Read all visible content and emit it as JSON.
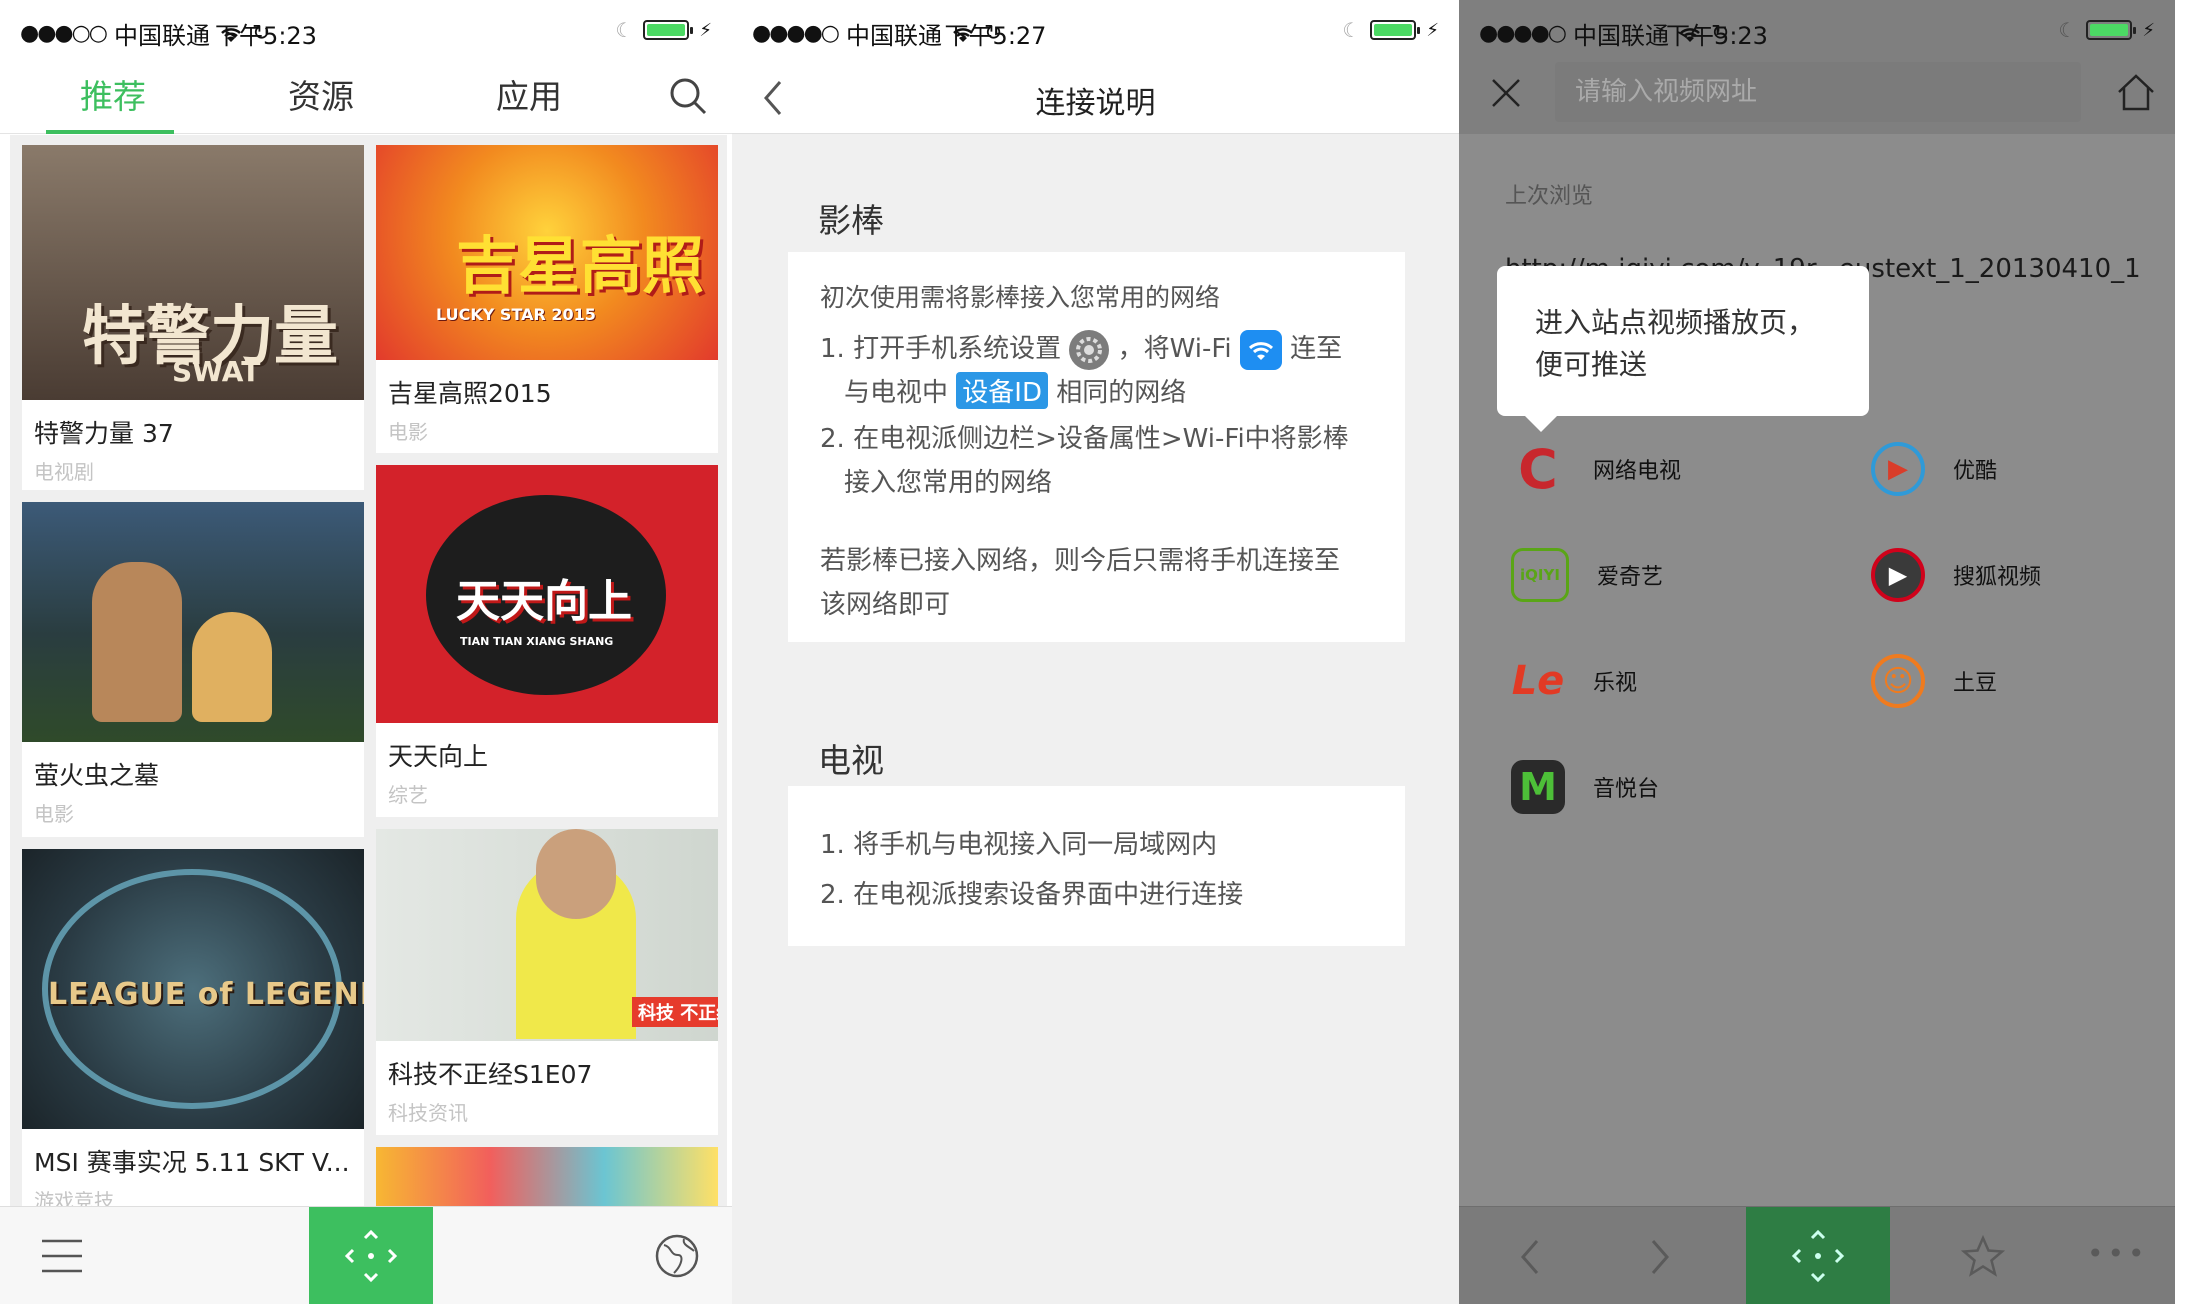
{
  "status": {
    "carrier": "中国联通",
    "time_screen1": "下午5:23",
    "time_screen2": "下午5:27",
    "time_screen3": "下午5:23"
  },
  "screen1": {
    "tabs": [
      {
        "label": "推荐"
      },
      {
        "label": "资源"
      },
      {
        "label": "应用"
      }
    ],
    "cards": [
      {
        "title": "特警力量 37",
        "sub": "电视剧",
        "thumb_text": "特警力量",
        "thumb_text2": "SWAT",
        "bg": "#5b4a3f"
      },
      {
        "title": "吉星高照2015",
        "sub": "电影",
        "thumb_text": "吉星高照",
        "thumb_text2": "LUCKY STAR 2015",
        "bg": "#e7472f"
      },
      {
        "title": "萤火虫之墓",
        "sub": "电影",
        "thumb_text": "",
        "thumb_text2": "",
        "bg": "#33495c"
      },
      {
        "title": "天天向上",
        "sub": "综艺",
        "thumb_text": "天天向上",
        "thumb_text2": "TIAN TIAN XIANG SHANG",
        "bg": "#d3222a"
      },
      {
        "title": "MSI 赛事实况 5.11 SKT V...",
        "sub": "游戏竞技",
        "thumb_text": "LEAGUE of LEGENDS",
        "thumb_text2": "",
        "bg": "#2c3a44"
      },
      {
        "title": "科技不正经S1E07",
        "sub": "科技资讯",
        "thumb_text": "科技 不正经",
        "thumb_text2": "",
        "bg": "#d9ded9"
      }
    ]
  },
  "screen2": {
    "title": "连接说明",
    "section1_title": "影棒",
    "s1_intro": "初次使用需将影棒接入您常用的网络",
    "s1_l1a": "1. 打开手机系统设置",
    "s1_l1b": "，将Wi-Fi",
    "s1_l1c": "连至",
    "s1_l2a": "与电视中",
    "s1_l2pill": "设备ID",
    "s1_l2b": "相同的网络",
    "s1_l3": "2. 在电视派侧边栏>设备属性>Wi-Fi中将影棒",
    "s1_l4": "接入您常用的网络",
    "s1_note1": "若影棒已接入网络，则今后只需将手机连接至",
    "s1_note2": "该网络即可",
    "section2_title": "电视",
    "s2_l1": "1. 将手机与电视接入同一局域网内",
    "s2_l2": "2. 在电视派搜索设备界面中进行连接"
  },
  "screen3": {
    "url_placeholder": "请输入视频网址",
    "recent_label": "上次浏览",
    "recent_url": "http://m.iqiyi.com/v_19r...eustext_1_20130410_1",
    "tooltip": "进入站点视频播放页，便可推送",
    "sites": [
      {
        "label": "网络电视",
        "icon": "cntv-icon",
        "glyph": "C",
        "color": "#c8272d",
        "bg": "#ffffff"
      },
      {
        "label": "优酷",
        "icon": "youku-icon",
        "glyph": "▶",
        "color": "#2f9ad8",
        "bg": "#ffffff"
      },
      {
        "label": "爱奇艺",
        "icon": "iqiyi-icon",
        "glyph": "iQIYI",
        "color": "#5aa517",
        "bg": "#ffffff"
      },
      {
        "label": "搜狐视频",
        "icon": "sohu-icon",
        "glyph": "▶",
        "color": "#d0021b",
        "bg": "#ffffff"
      },
      {
        "label": "乐视",
        "icon": "letv-icon",
        "glyph": "Le",
        "color": "#e23a24",
        "bg": "#ffffff"
      },
      {
        "label": "土豆",
        "icon": "tudou-icon",
        "glyph": "☺",
        "color": "#ef7b1f",
        "bg": "#ffffff"
      },
      {
        "label": "音悦台",
        "icon": "yinyuetai-icon",
        "glyph": "M",
        "color": "#4dbf38",
        "bg": "#2a2a2a"
      }
    ]
  },
  "colors": {
    "accent": "#3dbf5f",
    "blue": "#2b97e6"
  }
}
